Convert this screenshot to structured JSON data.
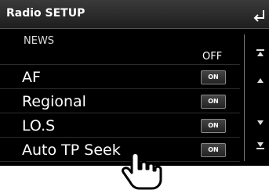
{
  "header": {
    "title": "Radio SETUP",
    "back_icon": "back-arrow-icon"
  },
  "news": {
    "label": "NEWS",
    "value": "OFF"
  },
  "settings": [
    {
      "label": "AF",
      "toggle": "ON"
    },
    {
      "label": "Regional",
      "toggle": "ON"
    },
    {
      "label": "LO.S",
      "toggle": "ON"
    },
    {
      "label": "Auto TP Seek",
      "toggle": "ON"
    }
  ],
  "scroll": {
    "icons": [
      "scroll-top-icon",
      "scroll-up-icon",
      "scroll-down-icon",
      "scroll-bottom-icon"
    ]
  }
}
